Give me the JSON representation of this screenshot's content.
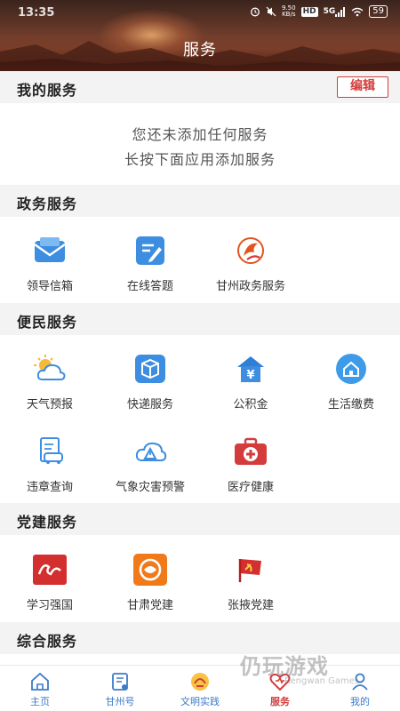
{
  "status": {
    "time": "13:35",
    "net_speed_value": "9.50",
    "net_speed_unit": "KB/s",
    "hd": "HD",
    "signal": "5G",
    "battery": "59"
  },
  "header": {
    "title": "服务"
  },
  "my_services": {
    "title": "我的服务",
    "edit_label": "编辑",
    "empty_line1": "您还未添加任何服务",
    "empty_line2": "长按下面应用添加服务"
  },
  "gov_services": {
    "title": "政务服务",
    "items": [
      {
        "label": "领导信箱",
        "icon": "mailbox-icon"
      },
      {
        "label": "在线答题",
        "icon": "quiz-icon"
      },
      {
        "label": "甘州政务服务",
        "icon": "gov-logo-icon"
      }
    ]
  },
  "convenience_services": {
    "title": "便民服务",
    "items": [
      {
        "label": "天气预报",
        "icon": "weather-icon"
      },
      {
        "label": "快递服务",
        "icon": "package-icon"
      },
      {
        "label": "公积金",
        "icon": "housing-fund-icon"
      },
      {
        "label": "生活缴费",
        "icon": "home-bill-icon"
      },
      {
        "label": "违章查询",
        "icon": "traffic-violation-icon"
      },
      {
        "label": "气象灾害预警",
        "icon": "weather-warning-icon"
      },
      {
        "label": "医疗健康",
        "icon": "medical-kit-icon"
      }
    ]
  },
  "party_services": {
    "title": "党建服务",
    "items": [
      {
        "label": "学习强国",
        "icon": "xuexi-logo-icon"
      },
      {
        "label": "甘肃党建",
        "icon": "gansu-party-logo-icon"
      },
      {
        "label": "张掖党建",
        "icon": "party-flag-icon"
      }
    ]
  },
  "comprehensive_services": {
    "title": "综合服务"
  },
  "bottom_nav": [
    {
      "label": "主页",
      "icon": "home-icon"
    },
    {
      "label": "甘州号",
      "icon": "news-icon"
    },
    {
      "label": "文明实践",
      "icon": "civilization-icon"
    },
    {
      "label": "服务",
      "icon": "heart-icon",
      "active": true
    },
    {
      "label": "我的",
      "icon": "profile-icon"
    }
  ],
  "watermark": {
    "main": "仍玩游戏",
    "sub": "Rengwan Games"
  },
  "colors": {
    "accent_red": "#d43c3c",
    "nav_blue": "#3b7bc8",
    "section_bg": "#f3f3f3"
  }
}
